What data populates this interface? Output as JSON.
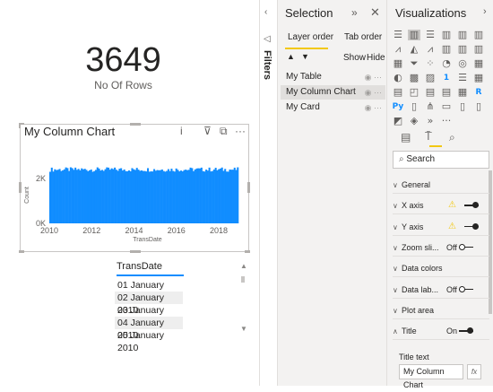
{
  "card": {
    "value": "3649",
    "label": "No Of Rows"
  },
  "chart": {
    "title": "My Column Chart",
    "tools": {
      "info": "i",
      "filter": "⊽",
      "focus": "⧉",
      "more": "···"
    }
  },
  "chart_data": {
    "type": "bar",
    "title": "My Column Chart",
    "xlabel": "TransDate",
    "ylabel": "Count",
    "x_ticks": [
      "2010",
      "2012",
      "2014",
      "2016",
      "2018"
    ],
    "y_ticks": [
      "0K",
      "2K"
    ],
    "ylim": [
      0,
      3000
    ],
    "xlim": [
      2010,
      2020
    ],
    "approx_value": 2400,
    "grid": false,
    "legend": "none",
    "color": "#118dff"
  },
  "table": {
    "header": "TransDate",
    "rows": [
      "01 January 2010",
      "02 January 2010",
      "03 January 2010",
      "04 January 2010",
      "05 January 2010"
    ]
  },
  "filters": {
    "label": "Filters"
  },
  "selection": {
    "title": "Selection",
    "tabs": [
      "Layer order",
      "Tab order"
    ],
    "show": "Show",
    "hide": "Hide",
    "layers": [
      {
        "name": "My Table"
      },
      {
        "name": "My Column Chart"
      },
      {
        "name": "My Card"
      }
    ]
  },
  "visualizations": {
    "title": "Visualizations",
    "search_placeholder": "Search",
    "sections": [
      {
        "label": "General"
      },
      {
        "label": "X axis"
      },
      {
        "label": "Y axis"
      },
      {
        "label": "Zoom sli...",
        "state": "Off"
      },
      {
        "label": "Data colors"
      },
      {
        "label": "Data lab...",
        "state": "Off"
      },
      {
        "label": "Plot area"
      },
      {
        "label": "Title",
        "state": "On"
      }
    ],
    "title_text_label": "Title text",
    "title_text_value": "My Column Chart",
    "fx": "fx",
    "colors": {
      "accent": "#f2c811",
      "blue": "#118dff"
    }
  }
}
